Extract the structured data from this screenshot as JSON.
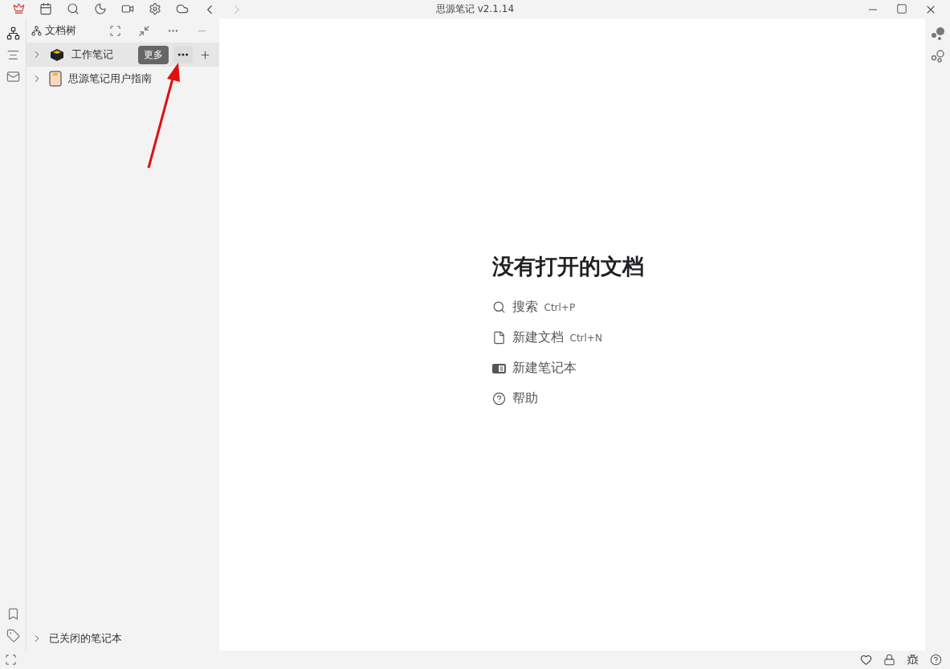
{
  "window": {
    "title": "思源笔记 v2.1.14"
  },
  "file_tree": {
    "title": "文档树",
    "tooltip": "更多",
    "notebooks": [
      {
        "name": "工作笔记",
        "kind": "box",
        "hovered": true
      },
      {
        "name": "思源笔记用户指南",
        "kind": "book",
        "hovered": false
      }
    ],
    "closed_notebooks": "已关闭的笔记本"
  },
  "empty_state": {
    "title": "没有打开的文档",
    "actions": [
      {
        "kind": "search",
        "label": "搜索",
        "shortcut": "Ctrl+P"
      },
      {
        "kind": "document",
        "label": "新建文档",
        "shortcut": "Ctrl+N"
      },
      {
        "kind": "notebook",
        "label": "新建笔记本"
      },
      {
        "kind": "help",
        "label": "帮助"
      }
    ]
  }
}
